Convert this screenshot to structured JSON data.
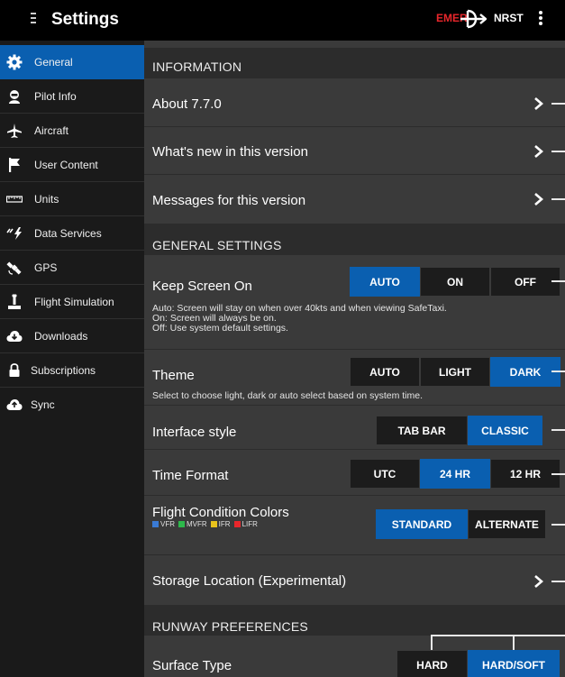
{
  "topbar": {
    "title": "Settings",
    "emer_label": "EMER",
    "nrst_label": "NRST",
    "emer_color": "#e8262b"
  },
  "sidebar": {
    "active_color": "#0a5fb0",
    "items": [
      {
        "label": "General",
        "icon": "gear-icon"
      },
      {
        "label": "Pilot Info",
        "icon": "pilot-icon"
      },
      {
        "label": "Aircraft",
        "icon": "airplane-icon"
      },
      {
        "label": "User Content",
        "icon": "flag-icon"
      },
      {
        "label": "Units",
        "icon": "ruler-icon"
      },
      {
        "label": "Data Services",
        "icon": "data-services-icon"
      },
      {
        "label": "GPS",
        "icon": "satellite-icon"
      },
      {
        "label": "Flight Simulation",
        "icon": "joystick-icon"
      },
      {
        "label": "Downloads",
        "icon": "cloud-download-icon"
      },
      {
        "label": "Subscriptions",
        "icon": "lock-icon"
      },
      {
        "label": "Sync",
        "icon": "cloud-sync-icon"
      }
    ]
  },
  "main": {
    "information": {
      "header": "INFORMATION",
      "about": "About 7.7.0",
      "whats_new": "What's new in this version",
      "messages": "Messages for this version"
    },
    "general": {
      "header": "GENERAL SETTINGS",
      "keep_screen": {
        "title": "Keep Screen On",
        "options": [
          "AUTO",
          "ON",
          "OFF"
        ],
        "selected": "AUTO",
        "desc1": "Auto: Screen will stay on when over 40kts and when viewing SafeTaxi.",
        "desc2": "On: Screen will always be on.",
        "desc3": "Off: Use system default settings."
      },
      "theme": {
        "title": "Theme",
        "options": [
          "AUTO",
          "LIGHT",
          "DARK"
        ],
        "selected": "DARK",
        "desc": "Select to choose light, dark or auto select based on system time."
      },
      "interface": {
        "title": "Interface style",
        "options": [
          "TAB BAR",
          "CLASSIC"
        ],
        "selected": "CLASSIC"
      },
      "time_format": {
        "title": "Time Format",
        "options": [
          "UTC",
          "24 HR",
          "12 HR"
        ],
        "selected": "24 HR"
      },
      "flight_colors": {
        "title": "Flight Condition Colors",
        "options": [
          "STANDARD",
          "ALTERNATE"
        ],
        "selected": "STANDARD",
        "legend": [
          {
            "label": "VFR",
            "color": "#3a7bd5"
          },
          {
            "label": "MVFR",
            "color": "#2db84b"
          },
          {
            "label": "IFR",
            "color": "#e8c21c"
          },
          {
            "label": "LIFR",
            "color": "#e8262b"
          }
        ]
      },
      "storage": "Storage Location (Experimental)"
    },
    "runway": {
      "header": "RUNWAY PREFERENCES",
      "surface": {
        "title": "Surface Type",
        "options": [
          "HARD",
          "HARD/SOFT"
        ],
        "selected": "HARD/SOFT"
      }
    }
  }
}
